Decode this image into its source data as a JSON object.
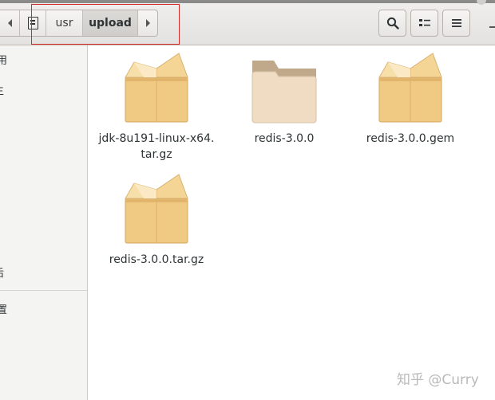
{
  "window": {
    "title": "upload"
  },
  "pathbar": {
    "back_icon": "chevron-left-icon",
    "home_icon": "home-icon",
    "segments": [
      {
        "label": "usr"
      },
      {
        "label": "upload",
        "active": true
      }
    ],
    "forward_icon": "chevron-right-icon"
  },
  "toolbar": {
    "search_icon": "search-icon",
    "view_icon": "list-view-icon",
    "menu_icon": "hamburger-menu-icon"
  },
  "sidebar": {
    "items": [
      {
        "label": "用"
      },
      {
        "label": "主"
      },
      {
        "label": "后"
      },
      {
        "label": "置"
      }
    ]
  },
  "files": [
    {
      "name_line1": "jdk-8u191-linux-x64.",
      "name_line2": "tar.gz",
      "type": "archive"
    },
    {
      "name_line1": "redis-3.0.0",
      "name_line2": "",
      "type": "folder"
    },
    {
      "name_line1": "redis-3.0.0.gem",
      "name_line2": "",
      "type": "archive"
    },
    {
      "name_line1": "redis-3.0.0.tar.gz",
      "name_line2": "",
      "type": "archive"
    }
  ],
  "watermark": "知乎 @Curry",
  "colors": {
    "annotation": "#d42a2a",
    "archive_body": "#f0c982",
    "folder_body": "#efdcc2"
  }
}
